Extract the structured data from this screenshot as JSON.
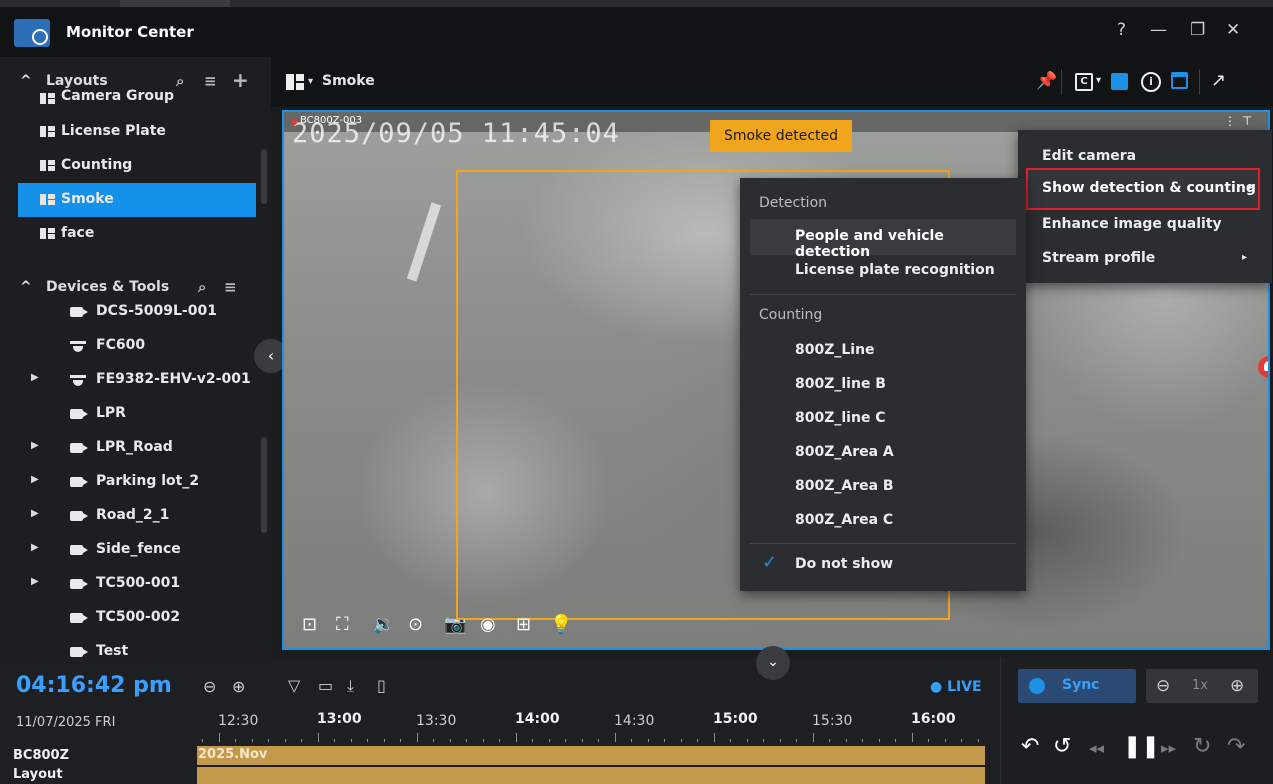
{
  "app": {
    "title": "Monitor Center",
    "help": "?",
    "minimize": "—",
    "restore": "❐",
    "close": "✕"
  },
  "sidebar": {
    "layouts_header": "Layouts",
    "layouts": [
      {
        "label": "Camera Group"
      },
      {
        "label": "License Plate"
      },
      {
        "label": "Counting"
      },
      {
        "label": "Smoke",
        "active": true
      },
      {
        "label": "face"
      }
    ],
    "devices_header": "Devices & Tools",
    "devices": [
      {
        "label": "DCS-5009L-001",
        "icon": "camera-icon",
        "expandable": false
      },
      {
        "label": "FC600",
        "icon": "dome-camera-icon",
        "expandable": false
      },
      {
        "label": "FE9382-EHV-v2-001",
        "icon": "dome-camera-icon",
        "expandable": true
      },
      {
        "label": "LPR",
        "icon": "camera-icon",
        "expandable": false
      },
      {
        "label": "LPR_Road",
        "icon": "camera-icon",
        "expandable": true
      },
      {
        "label": "Parking lot_2",
        "icon": "camera-icon",
        "expandable": true
      },
      {
        "label": "Road_2_1",
        "icon": "camera-icon",
        "expandable": true
      },
      {
        "label": "Side_fence",
        "icon": "camera-icon",
        "expandable": true
      },
      {
        "label": "TC500-001",
        "icon": "camera-icon",
        "expandable": true
      },
      {
        "label": "TC500-002",
        "icon": "camera-icon",
        "expandable": false
      },
      {
        "label": "Test",
        "icon": "camera-icon",
        "expandable": false
      }
    ]
  },
  "viewbar": {
    "layout_name": "Smoke"
  },
  "video": {
    "camera_label": "BC800Z-003",
    "timestamp": "2025/09/05 11:45:04",
    "event_badge": "Smoke detected"
  },
  "context_menu": {
    "items": [
      {
        "label": "Edit camera"
      },
      {
        "label": "Show detection & counting",
        "submenu": true,
        "highlighted": true
      },
      {
        "label": "Enhance image quality"
      },
      {
        "label": "Stream profile",
        "submenu": true
      }
    ]
  },
  "submenu": {
    "detection_header": "Detection",
    "detection_items": [
      "People and vehicle detection",
      "License plate recognition"
    ],
    "counting_header": "Counting",
    "counting_items": [
      "800Z_Line",
      "800Z_line B",
      "800Z_line C",
      "800Z_Area A",
      "800Z_Area B",
      "800Z_Area C"
    ],
    "do_not_show": "Do not show",
    "do_not_show_checked": true
  },
  "timeline": {
    "clock": "04:16:42 pm",
    "date": "11/07/2025 FRI",
    "live": "● LIVE",
    "ticks": [
      "12:30",
      "13:00",
      "13:30",
      "14:00",
      "14:30",
      "15:00",
      "15:30",
      "16:00"
    ],
    "tracks": [
      {
        "name": "BC800Z",
        "label": "2025.Nov"
      },
      {
        "name": "Layout",
        "label": ""
      }
    ],
    "sync_label": "Sync",
    "speed_label": "1x"
  },
  "colors": {
    "accent": "#1591ea",
    "alert": "#f0a51c",
    "highlight_border": "#e0202a",
    "track": "#c39a4b"
  }
}
